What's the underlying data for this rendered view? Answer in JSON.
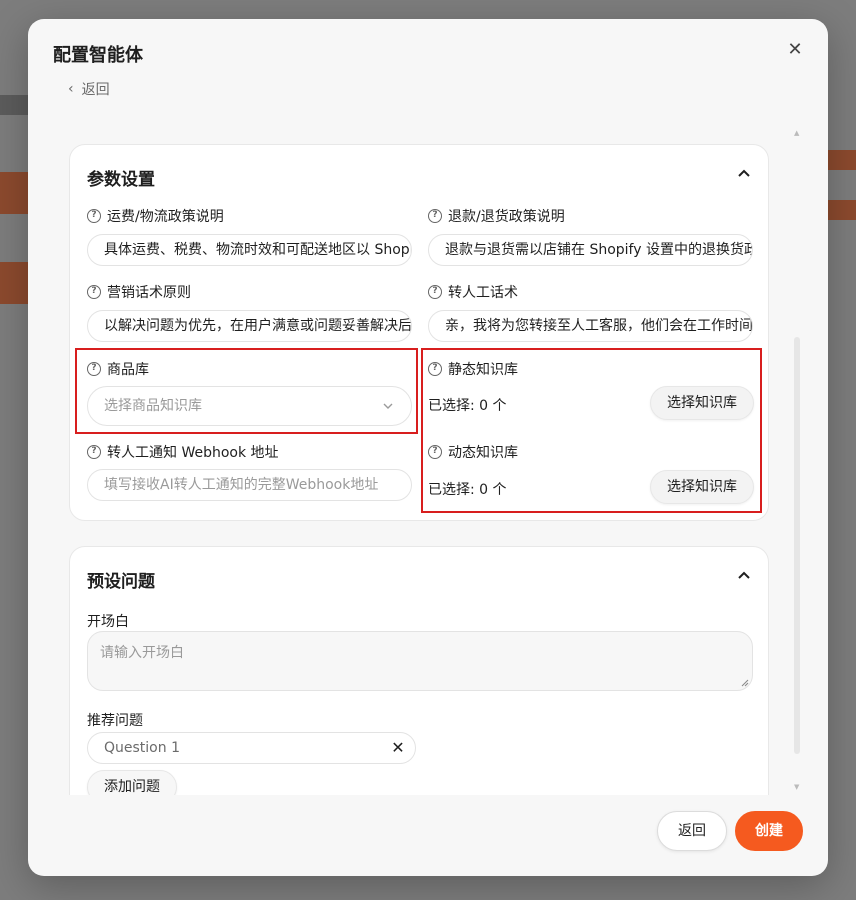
{
  "modal": {
    "title": "配置智能体",
    "close_icon": "close-icon",
    "back_link": "返回"
  },
  "params": {
    "title": "参数设置",
    "fields": {
      "shipping": {
        "label": "运费/物流政策说明",
        "value": "具体运费、税费、物流时效和可配送地区以 Shopify"
      },
      "refund": {
        "label": "退款/退货政策说明",
        "value": "退款与退货需以店铺在 Shopify 设置中的退换货政策为准"
      },
      "marketing": {
        "label": "营销话术原则",
        "value": "以解决问题为优先，在用户满意或问题妥善解决后再推荐"
      },
      "handoff": {
        "label": "转人工话术",
        "value": "亲，我将为您转接至人工客服，他们会在工作时间内回复您"
      },
      "product_lib": {
        "label": "商品库",
        "placeholder": "选择商品知识库"
      },
      "static_kb": {
        "label": "静态知识库",
        "selected": "已选择: 0 个",
        "button": "选择知识库"
      },
      "dynamic_kb": {
        "label": "动态知识库",
        "selected": "已选择: 0 个",
        "button": "选择知识库"
      },
      "webhook": {
        "label": "转人工通知 Webhook 地址",
        "placeholder": "填写接收AI转人工通知的完整Webhook地址"
      }
    }
  },
  "preset": {
    "title": "预设问题",
    "opening_label": "开场白",
    "opening_placeholder": "请输入开场白",
    "suggest_label": "推荐问题",
    "questions": [
      "Question 1"
    ],
    "add_button": "添加问题"
  },
  "footer": {
    "back_label": "返回",
    "create_label": "创建"
  },
  "colors": {
    "accent": "#f55a1f",
    "highlight": "#d81e1e"
  }
}
